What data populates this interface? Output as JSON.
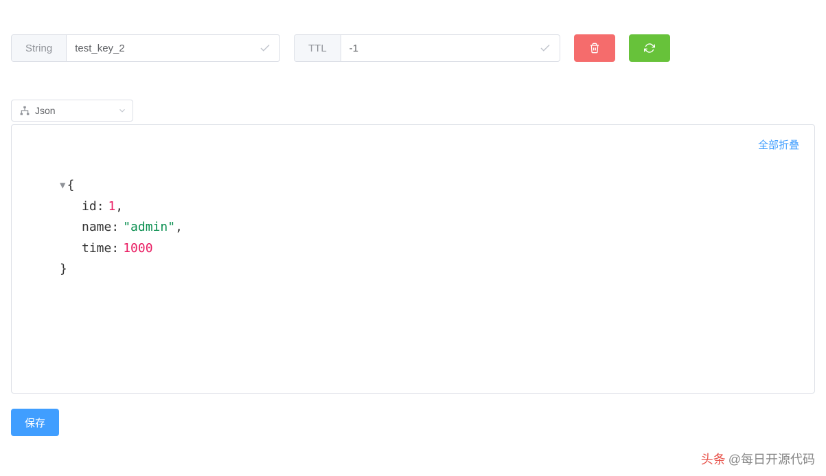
{
  "toolbar": {
    "type_label": "String",
    "key_value": "test_key_2",
    "ttl_label": "TTL",
    "ttl_value": "-1"
  },
  "format_selector": {
    "label": "Json"
  },
  "panel": {
    "collapse_all_label": "全部折叠"
  },
  "json_content": {
    "id_key": "id",
    "id_val": "1",
    "name_key": "name",
    "name_val": "\"admin\"",
    "time_key": "time",
    "time_val": "1000"
  },
  "actions": {
    "save_label": "保存"
  },
  "watermark": {
    "red": "头条",
    "text": "@每日开源代码"
  }
}
